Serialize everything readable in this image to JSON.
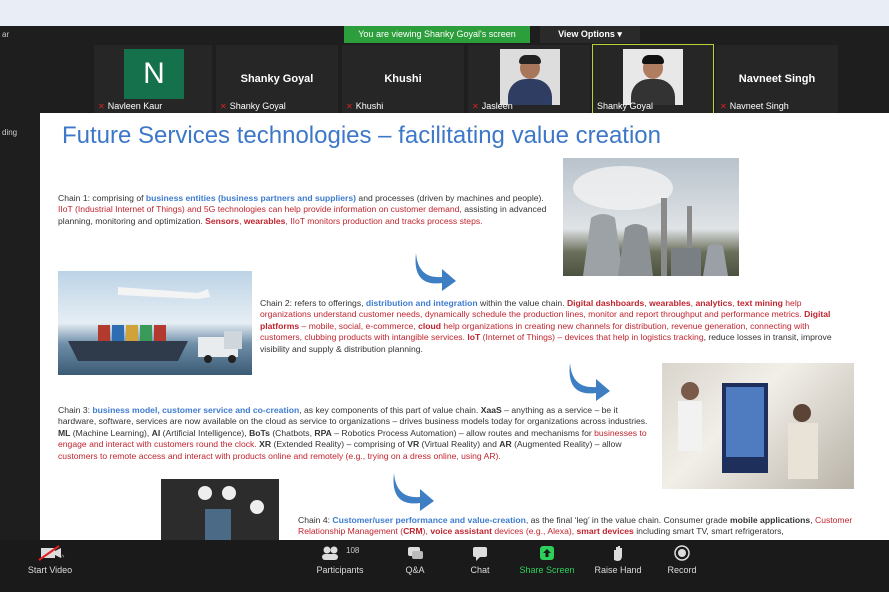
{
  "window": {
    "title_fragment": "ar",
    "side_fragment": "ding"
  },
  "banner": {
    "sharing_text": "You are viewing Shanky Goyal's screen",
    "view_options": "View Options"
  },
  "participants": [
    {
      "avatar_letter": "N",
      "tag": "Navleen Kaur"
    },
    {
      "display_name": "Shanky Goyal",
      "tag": "Shanky Goyal"
    },
    {
      "display_name": "Khushi",
      "tag": "Khushi"
    },
    {
      "tag": "Jasleen"
    },
    {
      "tag": "Shanky Goyal"
    },
    {
      "display_name": "Navneet Singh",
      "tag": "Navneet Singh"
    }
  ],
  "slide": {
    "title": "Future Services technologies – facilitating value creation",
    "chain1": [
      {
        "t": "Chain 1: comprising of ",
        "c": "n"
      },
      {
        "t": "business entities (business partners and suppliers)",
        "c": "hl"
      },
      {
        "t": " and processes (driven by machines and people). ",
        "c": "n"
      },
      {
        "t": "IIoT (Industrial Internet of Things) and 5G technologies can help provide information on customer demand,",
        "c": "rd"
      },
      {
        "t": " assisting in advanced planning, monitoring and optimization. ",
        "c": "n"
      },
      {
        "t": "Sensors",
        "c": "rdb"
      },
      {
        "t": ", ",
        "c": "rd"
      },
      {
        "t": "wearables",
        "c": "rdb"
      },
      {
        "t": ", IIoT monitors production and tracks process steps.",
        "c": "rd"
      }
    ],
    "chain2": [
      {
        "t": "Chain 2: refers to offerings, ",
        "c": "n"
      },
      {
        "t": "distribution and integration",
        "c": "hl"
      },
      {
        "t": " within the value chain. ",
        "c": "n"
      },
      {
        "t": "Digital dashboards",
        "c": "rdb"
      },
      {
        "t": ", ",
        "c": "rd"
      },
      {
        "t": "wearables",
        "c": "rdb"
      },
      {
        "t": ", ",
        "c": "rd"
      },
      {
        "t": "analytics",
        "c": "rdb"
      },
      {
        "t": ", ",
        "c": "rd"
      },
      {
        "t": "text mining",
        "c": "rdb"
      },
      {
        "t": " help organizations understand customer needs, dynamically schedule the production lines, monitor and report throughput and performance metrics. ",
        "c": "rd"
      },
      {
        "t": "Digital platforms",
        "c": "rdb"
      },
      {
        "t": " – mobile, social, e-commerce, ",
        "c": "rd"
      },
      {
        "t": "cloud",
        "c": "rdb"
      },
      {
        "t": " help organizations in creating new channels for distribution, revenue generation, connecting with customers, clubbing products with intangible services. ",
        "c": "rd"
      },
      {
        "t": "IoT",
        "c": "rdb"
      },
      {
        "t": " (Internet of Things) – devices that help in logistics tracking",
        "c": "rd"
      },
      {
        "t": ", reduce losses in transit, improve visibility and supply & distribution planning.",
        "c": "n"
      }
    ],
    "chain3": [
      {
        "t": "Chain 3: ",
        "c": "n"
      },
      {
        "t": "business model, customer service and co-creation",
        "c": "hl"
      },
      {
        "t": ", as key components of this part of value chain. ",
        "c": "n"
      },
      {
        "t": "XaaS",
        "c": "b"
      },
      {
        "t": " – anything as a service – be it hardware, software, services are now available on the cloud as service to organizations – drives business models today for organizations across industries. ",
        "c": "n"
      },
      {
        "t": "ML",
        "c": "b"
      },
      {
        "t": " (Machine Learning), ",
        "c": "n"
      },
      {
        "t": "AI",
        "c": "b"
      },
      {
        "t": " (Artificial Intelligence), ",
        "c": "n"
      },
      {
        "t": "BoTs",
        "c": "b"
      },
      {
        "t": " (Chatbots, ",
        "c": "n"
      },
      {
        "t": "RPA",
        "c": "b"
      },
      {
        "t": " – Robotics Process Automation) – allow routes and mechanisms for ",
        "c": "n"
      },
      {
        "t": "businesses to engage and interact with customers round the clock.",
        "c": "rd"
      },
      {
        "t": " ",
        "c": "n"
      },
      {
        "t": "XR",
        "c": "b"
      },
      {
        "t": " (Extended Reality) – comprising of ",
        "c": "n"
      },
      {
        "t": "VR",
        "c": "b"
      },
      {
        "t": " (Virtual Reality) and ",
        "c": "n"
      },
      {
        "t": "AR",
        "c": "b"
      },
      {
        "t": " (Augmented Reality) – allow ",
        "c": "n"
      },
      {
        "t": "customers to remote access and interact with products online and remotely (e.g., trying on a dress online, using AR).",
        "c": "rd"
      }
    ],
    "chain4": [
      {
        "t": "Chain 4: ",
        "c": "n"
      },
      {
        "t": "Customer/user performance and value-creation",
        "c": "hl"
      },
      {
        "t": ", as the final ‘leg’ in the value chain. Consumer grade ",
        "c": "n"
      },
      {
        "t": "mobile applications",
        "c": "b"
      },
      {
        "t": ", ",
        "c": "n"
      },
      {
        "t": "Customer Relationship Management (",
        "c": "rd"
      },
      {
        "t": "CRM",
        "c": "rdb"
      },
      {
        "t": "), ",
        "c": "rd"
      },
      {
        "t": "voice assistant",
        "c": "rdb"
      },
      {
        "t": " devices (e.g., Alexa), ",
        "c": "rd"
      },
      {
        "t": "smart devices",
        "c": "rdb"
      },
      {
        "t": " including smart TV, smart refrigerators,",
        "c": "n"
      }
    ]
  },
  "toolbar": {
    "start_video": "Start Video",
    "participants": "Participants",
    "participant_count": "108",
    "qa": "Q&A",
    "chat": "Chat",
    "share_screen": "Share Screen",
    "raise_hand": "Raise Hand",
    "record": "Record"
  },
  "colors": {
    "accent_green": "#2d9e3c",
    "title_blue": "#3d78c8",
    "highlight_red": "#c0242e"
  }
}
